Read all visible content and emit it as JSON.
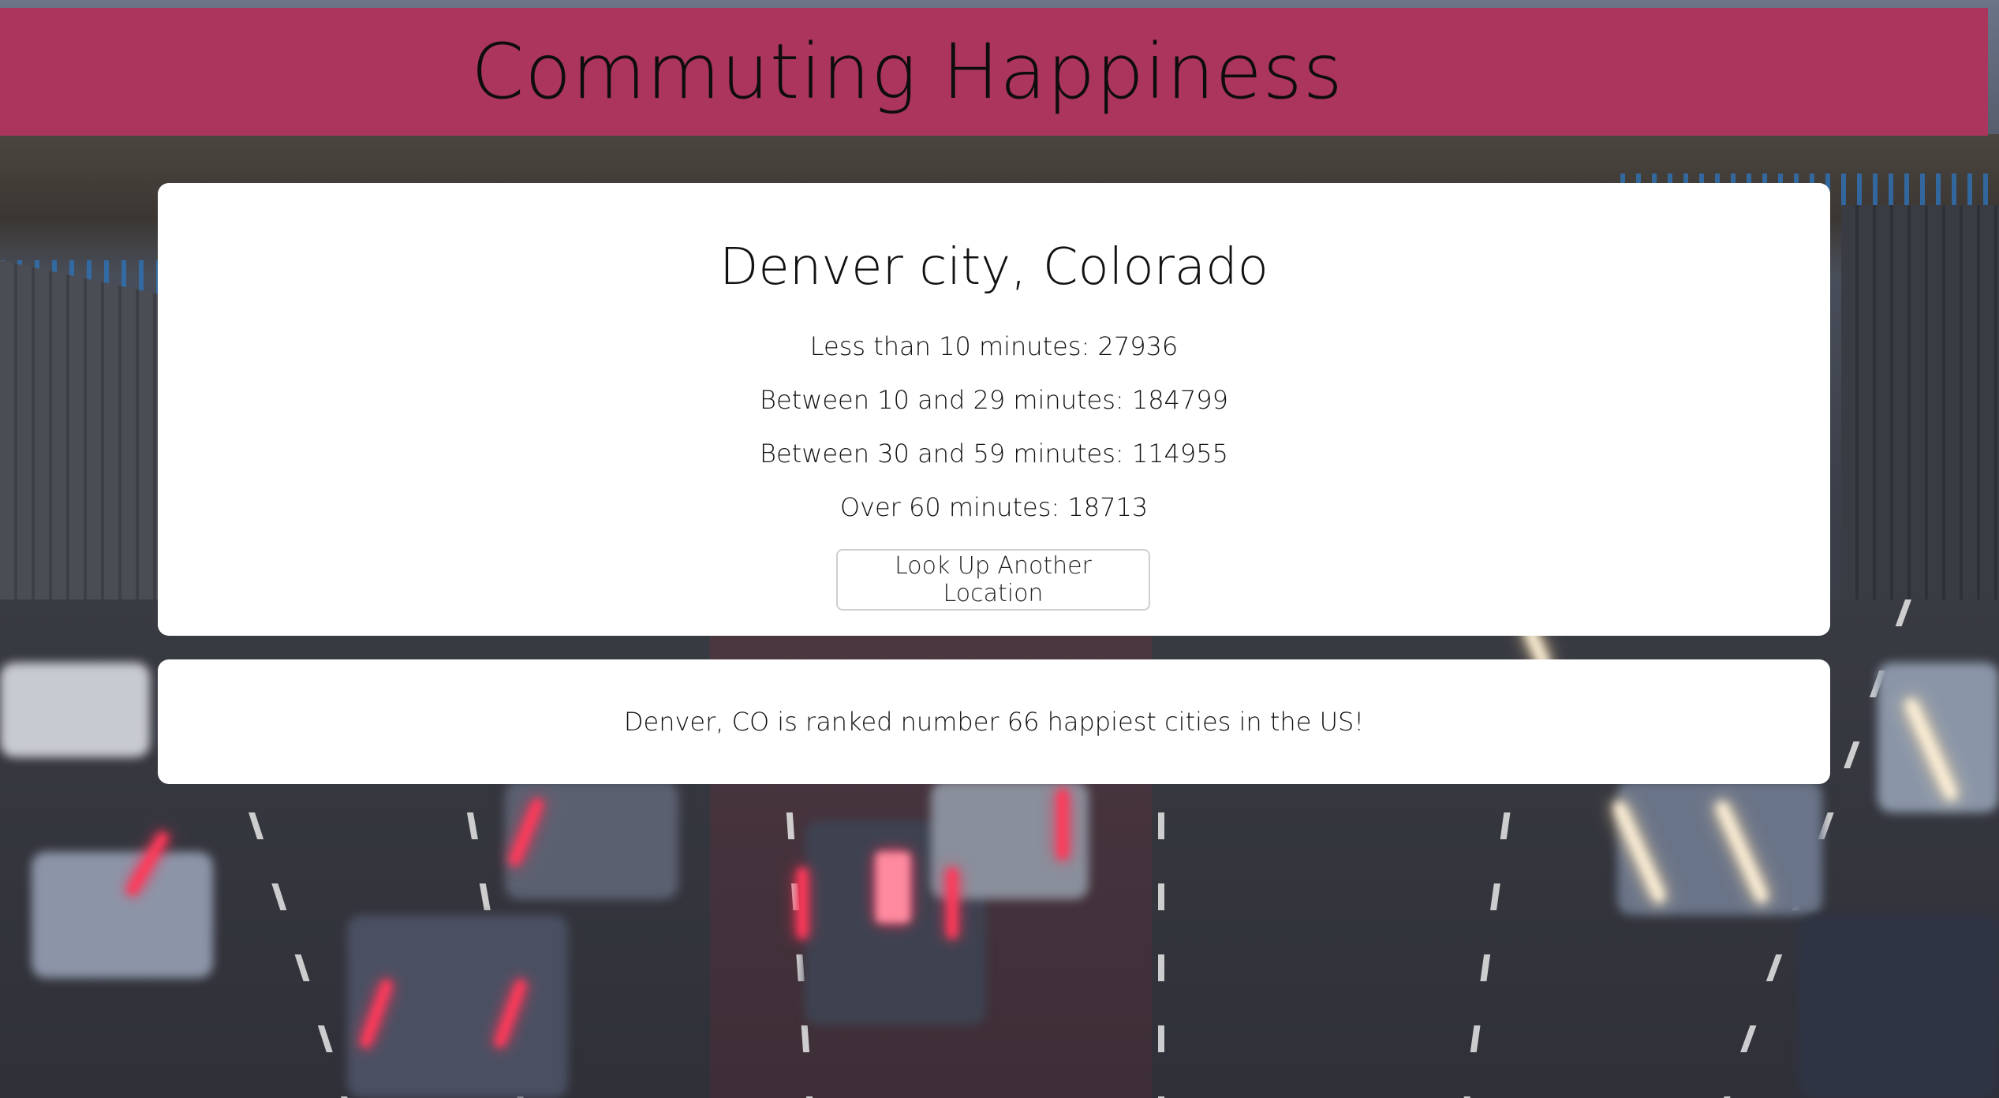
{
  "header": {
    "title": "Commuting Happiness"
  },
  "results": {
    "location": "Denver city, Colorado",
    "stats": [
      "Less than 10 minutes: 27936",
      "Between 10 and 29 minutes: 184799",
      "Between 30 and 59 minutes: 114955",
      "Over 60 minutes: 18713"
    ],
    "button_label": "Look Up Another Location"
  },
  "ranking": {
    "text": "Denver, CO is ranked number 66 happiest cities in the US!"
  },
  "colors": {
    "header_bg": "#ab355c",
    "card_bg": "#ffffff",
    "text": "#111111"
  }
}
